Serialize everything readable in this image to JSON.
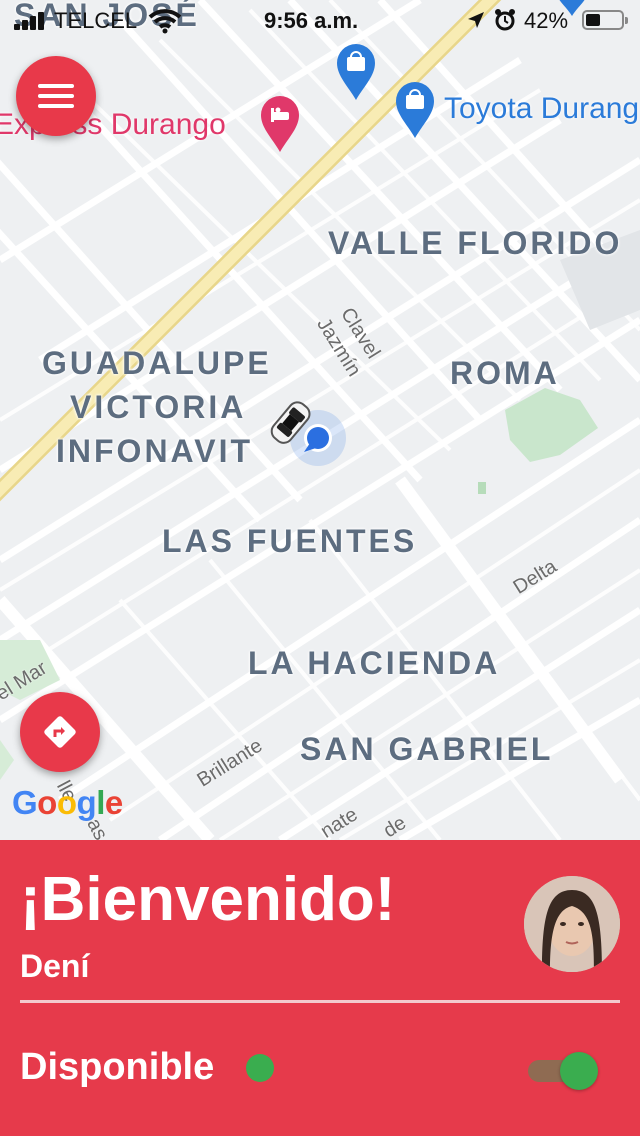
{
  "status_bar": {
    "carrier": "TELCEL",
    "time": "9:56 a.m.",
    "battery_percent": "42%",
    "battery_level": 0.42,
    "icons": [
      "signal-icon",
      "wifi-icon",
      "location-arrow-icon",
      "alarm-icon",
      "battery-icon"
    ]
  },
  "map": {
    "neighborhoods": {
      "san_jose": "SAN JOSÉ",
      "valle_florido": "VALLE FLORIDO",
      "guadalupe": "GUADALUPE",
      "victoria": "VICTORIA",
      "infonavit": "INFONAVIT",
      "roma": "ROMA",
      "las_fuentes": "LAS FUENTES",
      "la_hacienda": "LA HACIENDA",
      "san_gabriel": "SAN GABRIEL"
    },
    "pois": {
      "express_durango": "Express Durango",
      "toyota_durango": "Toyota Durang"
    },
    "streets": {
      "clavel": "Clavel",
      "jazmin": "Jazmín",
      "delta": "Delta",
      "brillante": "Brillante",
      "del_mar": "el Mar",
      "calle": "lle",
      "as": "as",
      "nate": "nate",
      "de": "de"
    },
    "colors": {
      "poi_pink": "#e0386a",
      "poi_blue": "#2b7bd9",
      "neighborhood_text": "#5d6d80",
      "highway": "#f7e9a8"
    }
  },
  "buttons": {
    "menu_icon": "hamburger-menu-icon",
    "directions_icon": "directions-icon"
  },
  "branding": {
    "google": "Google"
  },
  "panel": {
    "welcome": "¡Bienvenido!",
    "driver_name": "Dení",
    "status_label": "Disponible",
    "available": true,
    "accent_color": "#e63a4b",
    "status_color": "#3aad4f"
  }
}
